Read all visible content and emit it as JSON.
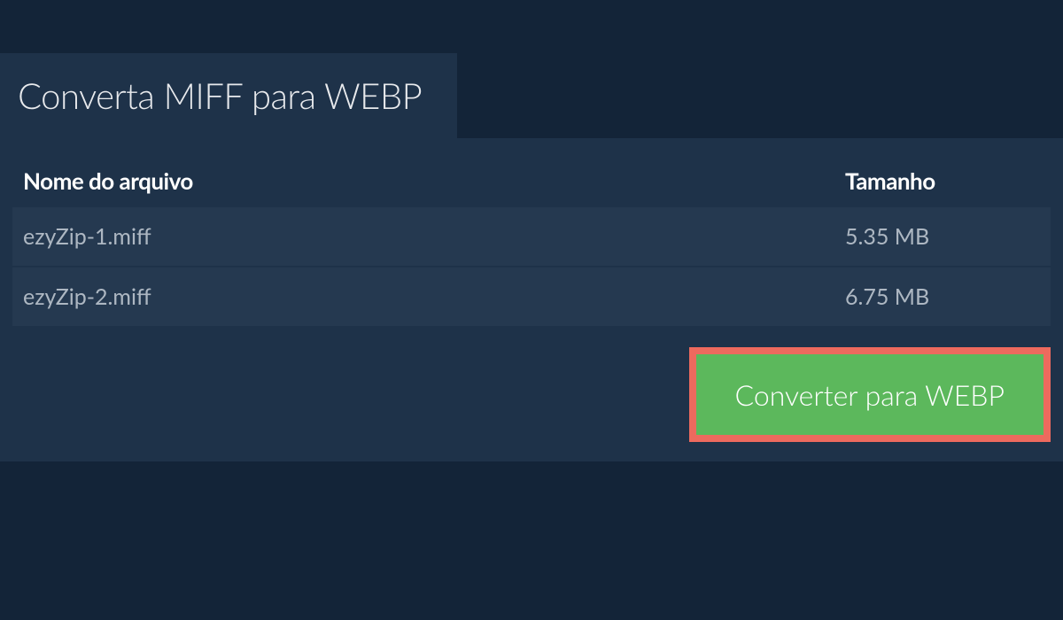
{
  "tab": {
    "title": "Converta MIFF para WEBP"
  },
  "table": {
    "headers": {
      "filename": "Nome do arquivo",
      "size": "Tamanho"
    },
    "rows": [
      {
        "filename": "ezyZip-1.miff",
        "size": "5.35 MB"
      },
      {
        "filename": "ezyZip-2.miff",
        "size": "6.75 MB"
      }
    ]
  },
  "actions": {
    "convert_label": "Converter para WEBP"
  }
}
